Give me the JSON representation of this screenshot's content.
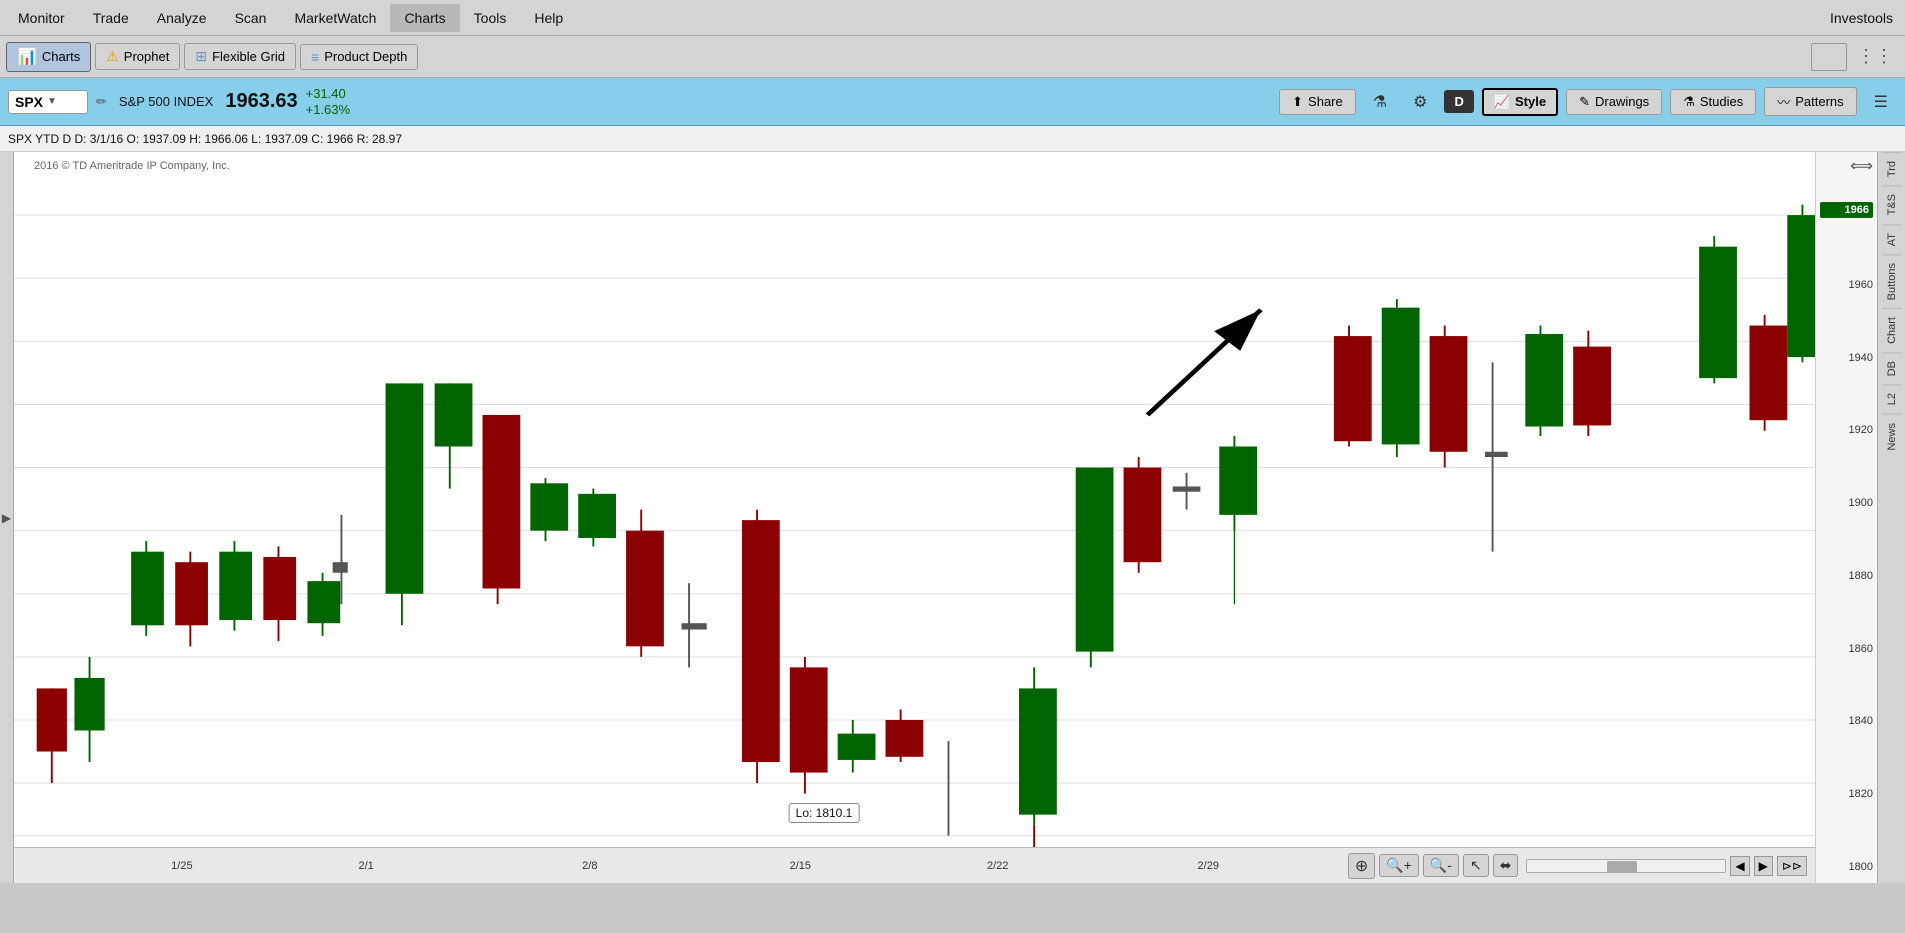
{
  "app": {
    "title": "Investools"
  },
  "menu": {
    "items": [
      "Monitor",
      "Trade",
      "Analyze",
      "Scan",
      "MarketWatch",
      "Charts",
      "Tools",
      "Help"
    ]
  },
  "toolbar": {
    "charts_label": "Charts",
    "prophet_label": "Prophet",
    "flexible_grid_label": "Flexible Grid",
    "product_depth_label": "Product Depth"
  },
  "symbol_bar": {
    "symbol": "SPX",
    "name": "S&P 500 INDEX",
    "price": "1963.63",
    "change": "+31.40",
    "change_pct": "+1.63%",
    "period": "D",
    "share_label": "Share",
    "style_label": "Style",
    "drawings_label": "Drawings",
    "studies_label": "Studies",
    "patterns_label": "Patterns"
  },
  "info_bar": {
    "text": "SPX YTD D  D: 3/1/16  O: 1937.09  H: 1966.06  L: 1937.09  C: 1966  R: 28.97"
  },
  "copyright": "2016 © TD Ameritrade IP Company, Inc.",
  "chart": {
    "low_label": "Lo: 1810.1",
    "price_levels": [
      "1966",
      "1960",
      "1940",
      "1920",
      "1900",
      "1880",
      "1860",
      "1840",
      "1820",
      "1800"
    ],
    "current_price": "1966",
    "date_labels": [
      "1/25",
      "2/1",
      "2/8",
      "2/15",
      "2/22",
      "2/29"
    ]
  },
  "right_tabs": {
    "items": [
      "Trd",
      "T&S",
      "AT",
      "Buttons",
      "Chart",
      "DB",
      "L2",
      "News"
    ]
  },
  "bottom_toolbar": {
    "zoom_in": "+",
    "zoom_in_glass": "🔍",
    "zoom_out": "🔍",
    "cursor": "↖",
    "marker": "📍"
  }
}
